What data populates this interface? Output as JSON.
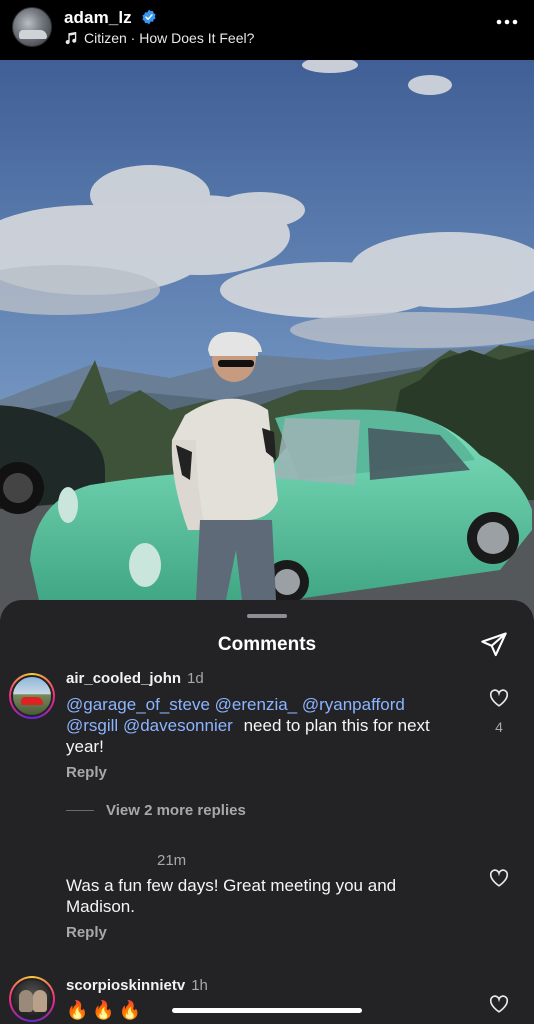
{
  "header": {
    "username": "adam_lz",
    "music": "Citizen · How Does It Feel?"
  },
  "comments_sheet": {
    "title": "Comments",
    "comments": [
      {
        "username": "air_cooled_john",
        "time": "1d",
        "mentions_line1": [
          "@garage_of_steve",
          "@erenzia_",
          "@ryanpafford"
        ],
        "mentions_line2": [
          "@rsgill",
          "@davesonnier"
        ],
        "text_after": "need to plan this for next",
        "text_line3": "year!",
        "reply_label": "Reply",
        "like_count": "4",
        "view_more_label": "View 2 more replies"
      },
      {
        "time": "21m",
        "text_line1": "Was a fun few days! Great meeting you and",
        "text_line2": "Madison.",
        "reply_label": "Reply"
      },
      {
        "username": "scorpioskinnietv",
        "time": "1h",
        "emoji": [
          "🔥",
          "🔥",
          "🔥"
        ]
      }
    ]
  },
  "colors": {
    "background": "#000000",
    "sheet": "#232326",
    "mention": "#8cb4ff",
    "verified": "#3897f0",
    "car": "#63d0a8"
  },
  "icons": [
    "verified-badge-icon",
    "music-note-icon",
    "more-options-icon",
    "send-icon",
    "heart-icon",
    "fire-emoji"
  ]
}
